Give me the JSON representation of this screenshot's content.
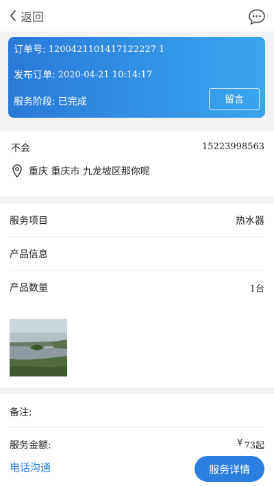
{
  "header": {
    "back_label": "返回",
    "icons": {
      "back": "chevron-left-icon",
      "message": "chat-bubble-icon"
    }
  },
  "order": {
    "number_label": "订单号:",
    "number": "1200421101417122227 1",
    "date_label": "发布订单:",
    "date": "2020-04-21 10:14:17",
    "stage_label": "服务阶段:",
    "stage": "已完成",
    "message_button": "留言"
  },
  "contact": {
    "name": "不会",
    "phone": "15223998563",
    "address": "重庆 重庆市 九龙坡区那你呢",
    "icons": {
      "address": "location-pin-icon"
    }
  },
  "service": {
    "rows": [
      {
        "label": "服务项目",
        "value": "热水器"
      },
      {
        "label": "产品信息",
        "value": ""
      },
      {
        "label": "产品数量",
        "value": "1台"
      }
    ]
  },
  "bottom": {
    "remark_label": "备注:",
    "amount_label": "服务金额:",
    "amount_symbol": "¥",
    "amount_value": "73起",
    "call_link": "电话沟通",
    "detail_button": "服务详情"
  },
  "colors": {
    "accent": "#2b7fe0",
    "card_gradient_start": "#2a7ad8",
    "card_gradient_end": "#3aa6ee",
    "background": "#f2f3f5"
  }
}
